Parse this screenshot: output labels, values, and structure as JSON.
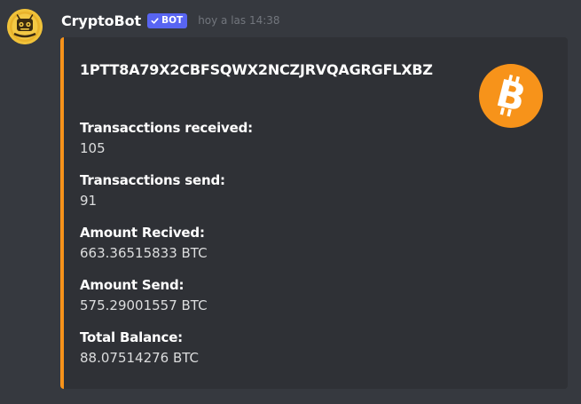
{
  "author": {
    "username": "CryptoBot",
    "bot_tag": "BOT",
    "timestamp": "hoy a las 14:38"
  },
  "embed": {
    "accent_color": "#f7931a",
    "title": "1PTT8A79X2CBFSQWX2NCZJRVQAGRGFLXBZ",
    "thumbnail_icon": "bitcoin-logo-icon",
    "fields": [
      {
        "name": "Transacctions received:",
        "value": "105"
      },
      {
        "name": "Transacctions send:",
        "value": "91"
      },
      {
        "name": "Amount Recived:",
        "value": "663.36515833 BTC"
      },
      {
        "name": "Amount Send:",
        "value": "575.29001557 BTC"
      },
      {
        "name": "Total Balance:",
        "value": "88.07514276 BTC"
      }
    ]
  }
}
